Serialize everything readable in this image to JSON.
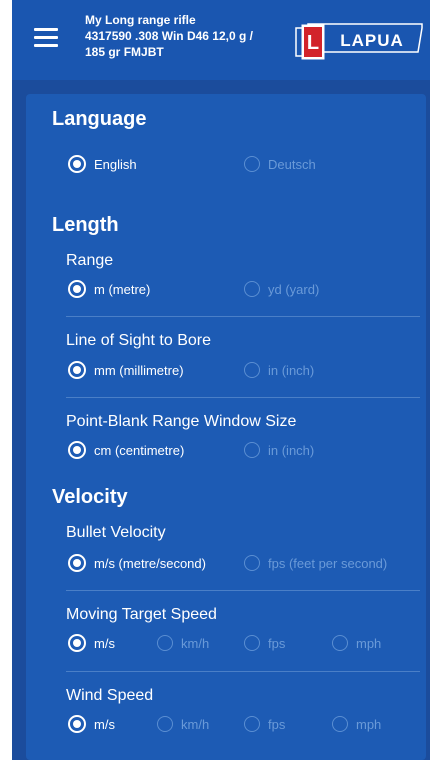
{
  "header": {
    "rifle_line1": "My Long range rifle",
    "rifle_line2": "4317590 .308 Win  D46 12,0 g /",
    "rifle_line3": "185 gr  FMJBT",
    "logo_text": "LAPUA",
    "logo_letter": "L"
  },
  "sections": {
    "language": {
      "title": "Language",
      "options": [
        {
          "label": "English",
          "selected": true
        },
        {
          "label": "Deutsch",
          "selected": false
        }
      ]
    },
    "length": {
      "title": "Length",
      "range": {
        "label": "Range",
        "options": [
          {
            "label": "m (metre)",
            "selected": true
          },
          {
            "label": "yd (yard)",
            "selected": false
          }
        ]
      },
      "line_of_sight": {
        "label": "Line of Sight to Bore",
        "options": [
          {
            "label": "mm (millimetre)",
            "selected": true
          },
          {
            "label": "in (inch)",
            "selected": false
          }
        ]
      },
      "point_blank": {
        "label": "Point-Blank Range Window Size",
        "options": [
          {
            "label": "cm (centimetre)",
            "selected": true
          },
          {
            "label": "in (inch)",
            "selected": false
          }
        ]
      }
    },
    "velocity": {
      "title": "Velocity",
      "bullet_velocity": {
        "label": "Bullet Velocity",
        "options": [
          {
            "label": "m/s (metre/second)",
            "selected": true
          },
          {
            "label": "fps (feet per  second)",
            "selected": false
          }
        ]
      },
      "moving_target": {
        "label": "Moving Target Speed",
        "options": [
          {
            "label": "m/s",
            "selected": true
          },
          {
            "label": "km/h",
            "selected": false
          },
          {
            "label": "fps",
            "selected": false
          },
          {
            "label": "mph",
            "selected": false
          }
        ]
      },
      "wind_speed": {
        "label": "Wind Speed",
        "options": [
          {
            "label": "m/s",
            "selected": true
          },
          {
            "label": "km/h",
            "selected": false
          },
          {
            "label": "fps",
            "selected": false
          },
          {
            "label": "mph",
            "selected": false
          }
        ]
      }
    }
  },
  "colors": {
    "appbar": "#1a56b0",
    "background": "#1b4c9c",
    "card": "#1d5bb4",
    "selected": "#ffffff",
    "unselected": "#6a9ad8"
  },
  "icons": {
    "menu": "hamburger-menu-icon",
    "radio_on": "radio-checked-icon",
    "radio_off": "radio-unchecked-icon"
  }
}
